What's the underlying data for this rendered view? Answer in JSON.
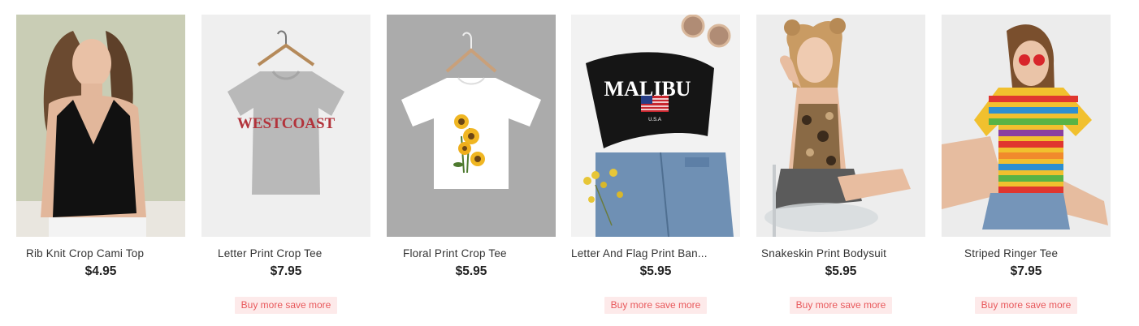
{
  "products": [
    {
      "title": "Rib Knit Crop Cami Top",
      "price": "$4.95",
      "badge": null
    },
    {
      "title": "Letter Print Crop Tee",
      "price": "$7.95",
      "badge": "Buy more save more",
      "print_text": "WESTCOAST"
    },
    {
      "title": "Floral Print Crop Tee",
      "price": "$5.95",
      "badge": null
    },
    {
      "title": "Letter And Flag Print Ban...",
      "price": "$5.95",
      "badge": "Buy more save more",
      "print_text": "MALIBU",
      "print_subtext": "U.S.A"
    },
    {
      "title": "Snakeskin Print Bodysuit",
      "price": "$5.95",
      "badge": "Buy more save more"
    },
    {
      "title": "Striped Ringer Tee",
      "price": "$7.95",
      "badge": "Buy more save more"
    }
  ],
  "colors": {
    "badge_bg": "#fdeaea",
    "badge_text": "#e8585b",
    "price_text": "#222222",
    "title_text": "#333333"
  }
}
